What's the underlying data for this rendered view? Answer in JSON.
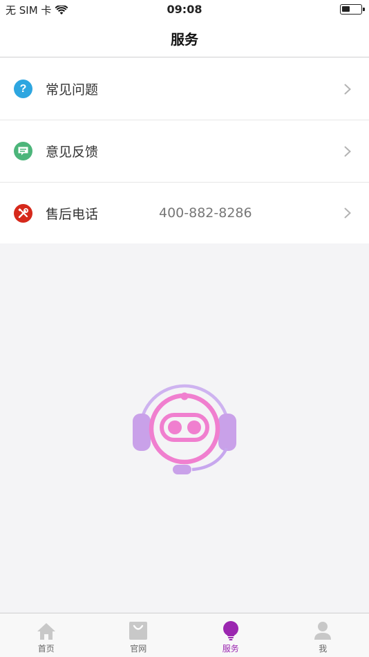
{
  "status_bar": {
    "carrier": "无 SIM 卡",
    "time": "09:08",
    "battery_level": 0.45
  },
  "nav": {
    "title": "服务"
  },
  "list": {
    "items": [
      {
        "label": "常见问题",
        "value": "",
        "icon": "question-icon",
        "color": "#2ea6e0"
      },
      {
        "label": "意见反馈",
        "value": "",
        "icon": "feedback-icon",
        "color": "#4cb57a"
      },
      {
        "label": "售后电话",
        "value": "400-882-8286",
        "icon": "tools-icon",
        "color": "#d6291b"
      }
    ]
  },
  "mascot": {
    "icon": "customer-service-robot-icon"
  },
  "tabs": [
    {
      "label": "首页",
      "icon": "home-icon",
      "active": false
    },
    {
      "label": "官网",
      "icon": "shopping-bag-icon",
      "active": false
    },
    {
      "label": "服务",
      "icon": "lightbulb-icon",
      "active": true
    },
    {
      "label": "我",
      "icon": "person-icon",
      "active": false
    }
  ],
  "colors": {
    "accent": "#9b27b0",
    "inactive": "#c8c8c8",
    "background": "#f4f4f6"
  }
}
